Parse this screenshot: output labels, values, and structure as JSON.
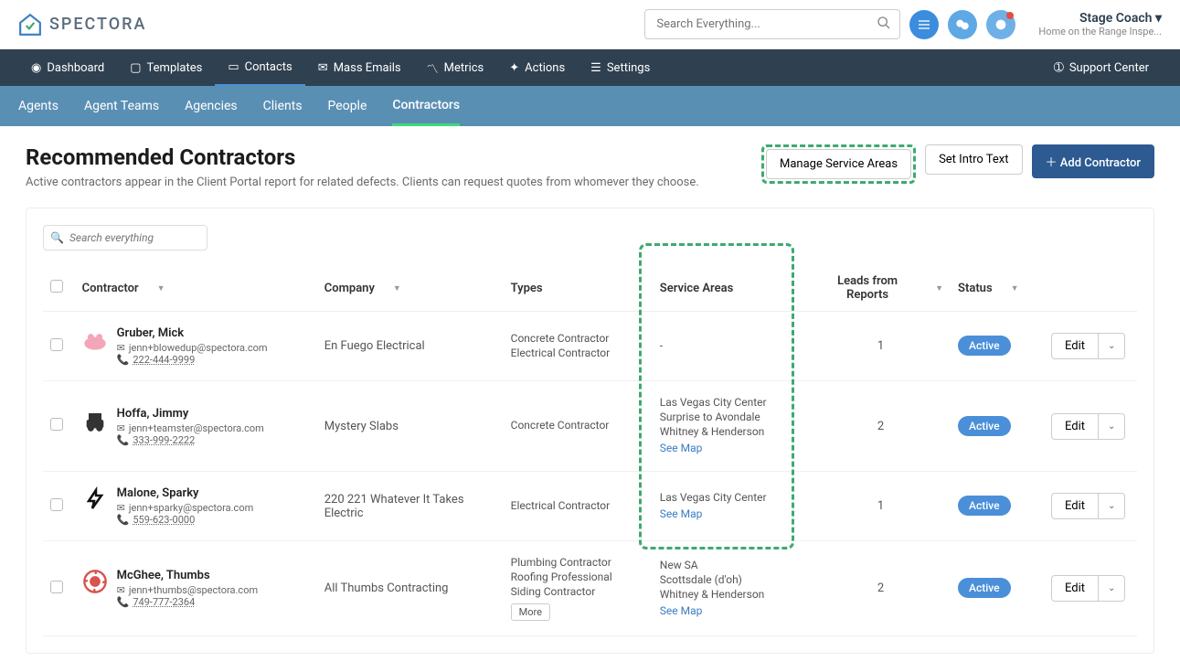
{
  "brand": "SPECTORA",
  "search": {
    "placeholder": "Search Everything..."
  },
  "user": {
    "name": "Stage Coach",
    "sub": "Home on the Range Inspe..."
  },
  "nav1": {
    "dashboard": "Dashboard",
    "templates": "Templates",
    "contacts": "Contacts",
    "massEmails": "Mass Emails",
    "metrics": "Metrics",
    "actions": "Actions",
    "settings": "Settings",
    "support": "Support Center"
  },
  "nav2": {
    "agents": "Agents",
    "agentTeams": "Agent Teams",
    "agencies": "Agencies",
    "clients": "Clients",
    "people": "People",
    "contractors": "Contractors"
  },
  "page": {
    "title": "Recommended Contractors",
    "subtitle": "Active contractors appear in the Client Portal report for related defects. Clients can request quotes from whomever they choose.",
    "manageServiceAreas": "Manage Service Areas",
    "setIntroText": "Set Intro Text",
    "addContractor": "Add Contractor"
  },
  "tableSearch": {
    "placeholder": "Search everything"
  },
  "columns": {
    "contractor": "Contractor",
    "company": "Company",
    "types": "Types",
    "serviceAreas": "Service Areas",
    "leads": "Leads from Reports",
    "status": "Status"
  },
  "editLabel": "Edit",
  "moreLabel": "More",
  "seeMapLabel": "See Map",
  "activeLabel": "Active",
  "rows": [
    {
      "name": "Gruber, Mick",
      "email": "jenn+blowedup@spectora.com",
      "phone": "222-444-9999",
      "company": "En Fuego Electrical",
      "types": [
        "Concrete Contractor",
        "Electrical Contractor"
      ],
      "serviceAreas": [
        "-"
      ],
      "seeMap": false,
      "more": false,
      "leads": "1",
      "status": "Active",
      "avatarColor": "#f2a6b8"
    },
    {
      "name": "Hoffa, Jimmy",
      "email": "jenn+teamster@spectora.com",
      "phone": "333-999-2222",
      "company": "Mystery Slabs",
      "types": [
        "Concrete Contractor"
      ],
      "serviceAreas": [
        "Las Vegas City Center",
        "Surprise to Avondale",
        "Whitney & Henderson"
      ],
      "seeMap": true,
      "more": false,
      "leads": "2",
      "status": "Active",
      "avatarColor": "#333"
    },
    {
      "name": "Malone, Sparky",
      "email": "jenn+sparky@spectora.com",
      "phone": "559-623-0000",
      "company": "220 221 Whatever It Takes Electric",
      "types": [
        "Electrical Contractor"
      ],
      "serviceAreas": [
        "Las Vegas City Center"
      ],
      "seeMap": true,
      "more": false,
      "leads": "1",
      "status": "Active",
      "avatarColor": "#111"
    },
    {
      "name": "McGhee, Thumbs",
      "email": "jenn+thumbs@spectora.com",
      "phone": "749-777-2364",
      "company": "All Thumbs Contracting",
      "types": [
        "Plumbing Contractor",
        "Roofing Professional",
        "Siding Contractor"
      ],
      "serviceAreas": [
        "New SA",
        "Scottsdale (d'oh)",
        "Whitney & Henderson"
      ],
      "seeMap": true,
      "more": true,
      "leads": "2",
      "status": "Active",
      "avatarColor": "#d9534f"
    }
  ]
}
